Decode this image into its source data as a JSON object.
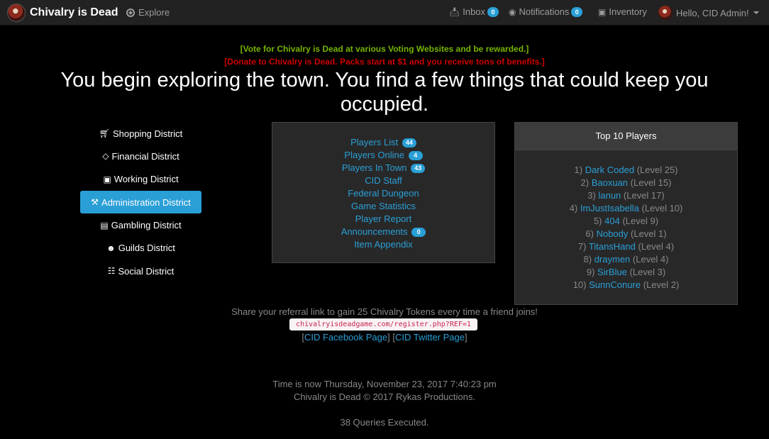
{
  "navbar": {
    "brand": "Chivalry is Dead",
    "explore": "Explore",
    "inbox_label": "Inbox",
    "inbox_count": "0",
    "notifications_label": "Notifications",
    "notifications_count": "0",
    "inventory_label": "Inventory",
    "user_greeting": "Hello, CID Admin!"
  },
  "notices": {
    "vote": "[Vote for Chivalry is Dead at various Voting Websites and be rewarded.]",
    "donate": "[Donate to Chivalry is Dead. Packs start at $1 and you receive tons of benefits.]"
  },
  "headline": "You begin exploring the town. You find a few things that could keep you occupied.",
  "districts": [
    {
      "label": "Shopping District",
      "icon": "cart-icon"
    },
    {
      "label": "Financial District",
      "icon": "diamond-icon"
    },
    {
      "label": "Working District",
      "icon": "briefcase-icon"
    },
    {
      "label": "Administration District",
      "icon": "gavel-icon",
      "active": true
    },
    {
      "label": "Gambling District",
      "icon": "money-icon"
    },
    {
      "label": "Guilds District",
      "icon": "users-icon"
    },
    {
      "label": "Social District",
      "icon": "comments-icon"
    }
  ],
  "town_links": {
    "players_list": "Players List",
    "players_list_count": "44",
    "players_online": "Players Online",
    "players_online_count": "4",
    "players_in_town": "Players In Town",
    "players_in_town_count": "43",
    "cid_staff": "CID Staff",
    "federal_dungeon": "Federal Dungeon",
    "game_statistics": "Game Statistics",
    "player_report": "Player Report",
    "announcements": "Announcements",
    "announcements_count": "0",
    "item_appendix": "Item Appendix"
  },
  "top_players": {
    "heading": "Top 10 Players",
    "players": [
      {
        "rank": "1)",
        "name": "Dark Coded",
        "level": "(Level 25)"
      },
      {
        "rank": "2)",
        "name": "Baoxuan",
        "level": "(Level 15)"
      },
      {
        "rank": "3)",
        "name": "lanun",
        "level": "(Level 17)"
      },
      {
        "rank": "4)",
        "name": "ImJustIsabella",
        "level": "(Level 10)"
      },
      {
        "rank": "5)",
        "name": "404",
        "level": "(Level 9)"
      },
      {
        "rank": "6)",
        "name": "Nobody",
        "level": "(Level 1)"
      },
      {
        "rank": "7)",
        "name": "TitansHand",
        "level": "(Level 4)"
      },
      {
        "rank": "8)",
        "name": "draymen",
        "level": "(Level 4)"
      },
      {
        "rank": "9)",
        "name": "SirBlue",
        "level": "(Level 3)"
      },
      {
        "rank": "10)",
        "name": "SunnConure",
        "level": "(Level 2)"
      }
    ]
  },
  "referral": {
    "text": "Share your referral link to gain 25 Chivalry Tokens every time a friend joins!",
    "link": "chivalryisdeadgame.com/register.php?REF=1",
    "facebook": "CID Facebook Page",
    "twitter": "CID Twitter Page"
  },
  "footer": {
    "time": "Time is now Thursday, November 23, 2017 7:40:23 pm",
    "copyright": "Chivalry is Dead © 2017 Rykas Productions.",
    "queries": "38 Queries Executed."
  },
  "colors": {
    "accent": "#2a9fd6",
    "vote": "#77b300",
    "donate": "#cc0000",
    "navbar": "#222222",
    "panel": "#282828"
  }
}
